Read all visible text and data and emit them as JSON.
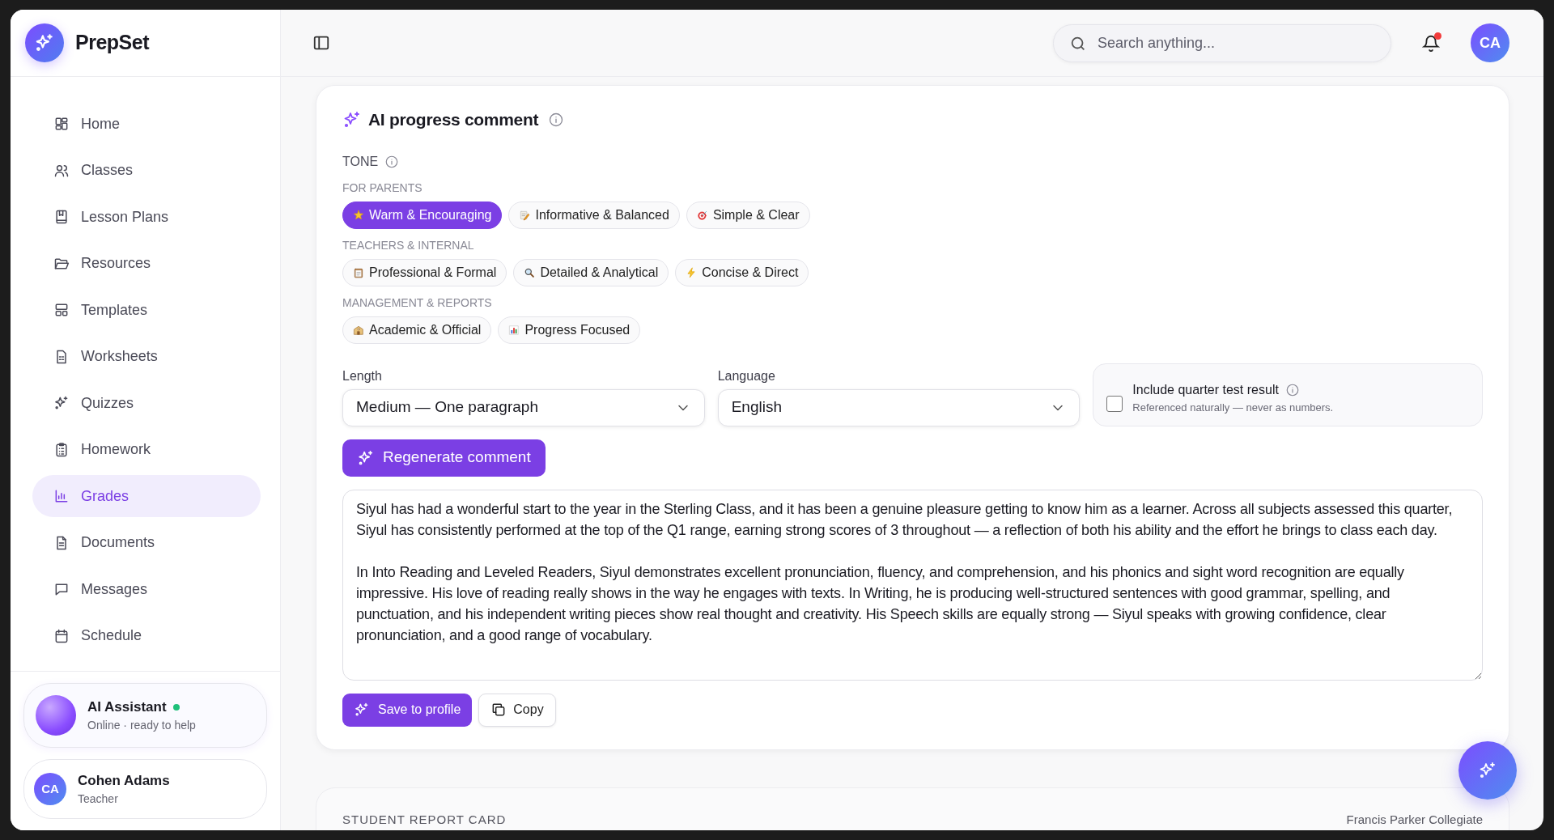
{
  "app": {
    "name": "PrepSet"
  },
  "sidebar": {
    "items": [
      {
        "label": "Home",
        "selected": false
      },
      {
        "label": "Classes",
        "selected": false
      },
      {
        "label": "Lesson Plans",
        "selected": false
      },
      {
        "label": "Resources",
        "selected": false
      },
      {
        "label": "Templates",
        "selected": false
      },
      {
        "label": "Worksheets",
        "selected": false
      },
      {
        "label": "Quizzes",
        "selected": false
      },
      {
        "label": "Homework",
        "selected": false
      },
      {
        "label": "Grades",
        "selected": true
      },
      {
        "label": "Documents",
        "selected": false
      },
      {
        "label": "Messages",
        "selected": false
      },
      {
        "label": "Schedule",
        "selected": false
      }
    ],
    "assistant": {
      "name": "AI Assistant",
      "status": "Online · ready to help",
      "online": true
    },
    "user": {
      "initials": "CA",
      "name": "Cohen Adams",
      "role": "Teacher"
    }
  },
  "header": {
    "search": {
      "placeholder": "Search anything..."
    },
    "notifications": true,
    "avatar": "CA"
  },
  "comment_card": {
    "title": "AI progress comment",
    "tone_label": "TONE",
    "groups": [
      {
        "label": "FOR PARENTS",
        "options": [
          {
            "label": "Warm & Encouraging",
            "selected": true
          },
          {
            "label": "Informative & Balanced",
            "selected": false
          },
          {
            "label": "Simple & Clear",
            "selected": false
          }
        ]
      },
      {
        "label": "TEACHERS & INTERNAL",
        "options": [
          {
            "label": "Professional & Formal",
            "selected": false
          },
          {
            "label": "Detailed & Analytical",
            "selected": false
          },
          {
            "label": "Concise & Direct",
            "selected": false
          }
        ]
      },
      {
        "label": "MANAGEMENT & REPORTS",
        "options": [
          {
            "label": "Academic & Official",
            "selected": false
          },
          {
            "label": "Progress Focused",
            "selected": false
          }
        ]
      }
    ],
    "length": {
      "label": "Length",
      "value": "Medium — One paragraph"
    },
    "language": {
      "label": "Language",
      "value": "English"
    },
    "include": {
      "label": "Include quarter test result",
      "hint": "Referenced naturally — never as numbers.",
      "checked": false
    },
    "regenerate": "Regenerate comment",
    "comment": [
      "Siyul has had a wonderful start to the year in the Sterling Class, and it has been a genuine pleasure getting to know him as a learner. Across all subjects assessed this quarter, Siyul has consistently performed at the top of the Q1 range, earning strong scores of 3 throughout — a reflection of both his ability and the effort he brings to class each day.",
      "In Into Reading and Leveled Readers, Siyul demonstrates excellent pronunciation, fluency, and comprehension, and his phonics and sight word recognition are equally impressive. His love of reading really shows in the way he engages with texts. In Writing, he is producing well-structured sentences with good grammar, spelling, and punctuation, and his independent writing pieces show real thought and creativity. His Speech skills are equally strong — Siyul speaks with growing confidence, clear pronunciation, and a good range of vocabulary."
    ],
    "actions": [
      "Save to profile",
      "Copy"
    ]
  },
  "report_card": {
    "title": "STUDENT REPORT CARD",
    "school": "Francis Parker Collegiate"
  }
}
